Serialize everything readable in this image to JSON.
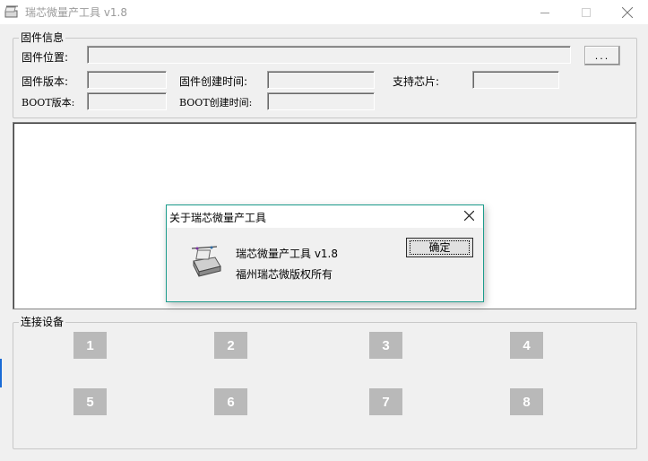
{
  "window": {
    "title": "瑞芯微量产工具 v1.8",
    "controls": {
      "minimize": "minimize-icon",
      "maximize": "maximize-icon",
      "close": "close-icon"
    }
  },
  "firmware_info": {
    "group_label": "固件信息",
    "location_label": "固件位置:",
    "location_value": "",
    "browse_label": "...",
    "version_label": "固件版本:",
    "version_value": "",
    "created_label": "固件创建时间:",
    "created_value": "",
    "chip_label": "支持芯片:",
    "chip_value": "",
    "boot_version_label": "BOOT版本:",
    "boot_version_value": "",
    "boot_created_label": "BOOT创建时间:",
    "boot_created_value": ""
  },
  "devices": {
    "group_label": "连接设备",
    "slots": [
      "1",
      "2",
      "3",
      "4",
      "5",
      "6",
      "7",
      "8"
    ]
  },
  "about_dialog": {
    "title": "关于瑞芯微量产工具",
    "product_line": "瑞芯微量产工具 v1.8",
    "copyright_line": "福州瑞芯微版权所有",
    "ok_label": "确定"
  }
}
